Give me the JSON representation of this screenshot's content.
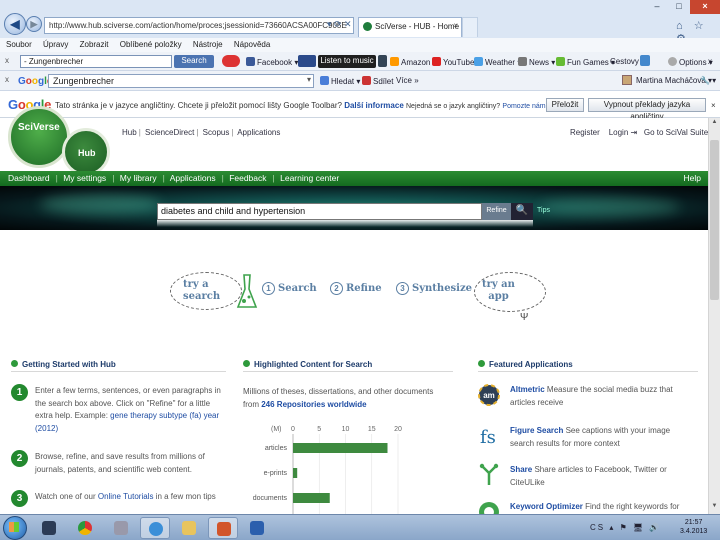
{
  "browser": {
    "back_glyph": "◀",
    "forward_glyph": "▶",
    "url": "http://www.hub.sciverse.com/action/home/proces;jsessionid=73660ACSA00FC905E",
    "address_icons": "▾ ⟳ ✕",
    "tab_title": "SciVerse - HUB - Home",
    "tab_close": "×",
    "window_min": "–",
    "window_max": "□",
    "window_close": "×",
    "right_icons": "⌂ ☆ ⚙",
    "menu": [
      "Soubor",
      "Úpravy",
      "Zobrazit",
      "Oblíbené položky",
      "Nástroje",
      "Nápověda"
    ]
  },
  "toolbar1": {
    "close": "x",
    "search_value": "- Zungenbrecher",
    "search_button": "Search",
    "facebook": "Facebook ▾",
    "listen": "Listen to music",
    "amazon": "Amazon",
    "youtube": "YouTube",
    "weather": "Weather ▾",
    "news": "News ▾",
    "fun_games": "Fun Games ▾",
    "cestovy": "Cestovy ▾",
    "options": "Options ▾",
    "close_right": "x"
  },
  "toolbar2": {
    "close": "x",
    "google_parts": [
      "G",
      "o",
      "o",
      "g",
      "l",
      "e"
    ],
    "search_value": "Zungenbrecher",
    "search_drop": "▾",
    "hledat": "Hledat ▾",
    "sdilet": "Sdílet",
    "vice": "Více »",
    "user": "Martina Macháčová ▾",
    "wrench": "🔧 ▾"
  },
  "translate_bar": {
    "logo_parts": [
      "G",
      "o",
      "o",
      "g",
      "l",
      "e"
    ],
    "message": "Tato stránka je v jazyce angličtiny. Chcete ji přeložit pomocí lišty Google Toolbar?",
    "more_info": "Další informace",
    "small1": "Nejedná se o jazyk angličtiny?",
    "small2": "Pomozte nám zlepšit se",
    "translate_button": "Přeložit",
    "disable_button": "Vypnout překlady jazyka angličtiny",
    "close": "×"
  },
  "site": {
    "logo": "SciVerse",
    "hub": "Hub",
    "top_links": [
      "Hub",
      "ScienceDirect",
      "Scopus",
      "Applications"
    ],
    "account_links": [
      "Register",
      "Login",
      "Go to SciVal Suite"
    ],
    "arrow_glyph": "⇥",
    "nav": [
      "Dashboard",
      "My settings",
      "My library",
      "Applications",
      "Feedback",
      "Learning center"
    ],
    "help": "Help",
    "search_value": "diabetes and child and hypertension",
    "refine_button": "Refine",
    "search_icon": "🔍",
    "tips": "Tips"
  },
  "workflow": {
    "try_search": [
      "try a",
      "search"
    ],
    "steps": [
      {
        "num": "1",
        "label": "Search"
      },
      {
        "num": "2",
        "label": "Refine"
      },
      {
        "num": "3",
        "label": "Synthesize"
      }
    ],
    "try_app": [
      "try an",
      "app"
    ],
    "fork": "Ψ"
  },
  "getting_started": {
    "heading": "Getting Started with Hub",
    "steps": [
      {
        "num": "1",
        "text": "Enter a few terms, sentences, or even paragraphs in the search box above. Click on \"Refine\" for a little extra help. Example:",
        "link": "gene therapy subtype (fa) year (2012)"
      },
      {
        "num": "2",
        "text": "Browse, refine, and save results from millions of journals, patents, and scientific web content."
      },
      {
        "num": "3",
        "text": "Watch one of our",
        "link": "Online Tutorials",
        "text_after": "in a few mon tips"
      }
    ]
  },
  "highlighted": {
    "heading": "Highlighted Content for Search",
    "text": "Millions of theses, dissertations, and other documents from",
    "strong": "246 Repositories worldwide",
    "chart_data": {
      "type": "bar",
      "orientation": "horizontal",
      "unit_label": "(M)",
      "ticks": [
        0,
        5,
        10,
        15,
        20
      ],
      "categories": [
        "articles",
        "e-prints",
        "documents"
      ],
      "values": [
        18,
        0.8,
        7
      ],
      "xlim": [
        0,
        20
      ]
    }
  },
  "featured": {
    "heading": "Featured Applications",
    "apps": [
      {
        "name": "Altmetric",
        "desc": "Measure the social media buzz that articles receive"
      },
      {
        "name": "Figure Search",
        "desc": "See captions with your image search results for more context"
      },
      {
        "name": "Share",
        "desc": "Share articles to Facebook, Twitter or CiteULike"
      },
      {
        "name": "Keyword Optimizer",
        "desc": "Find the right keywords for"
      }
    ]
  },
  "taskbar": {
    "tray": "CS ▴ ⚑ 🖥 🔊",
    "time": "21:57",
    "date": "3.4.2013"
  }
}
